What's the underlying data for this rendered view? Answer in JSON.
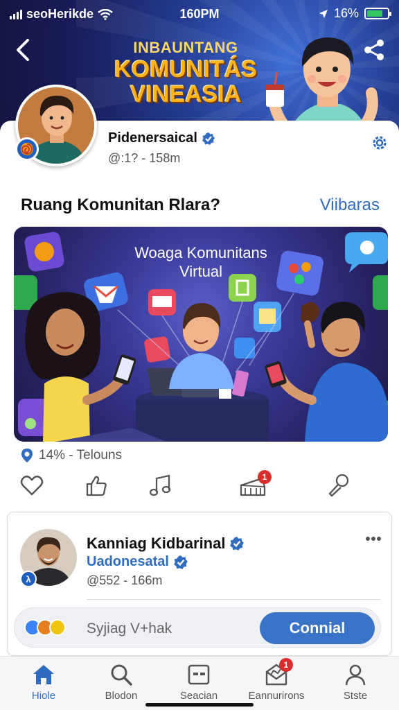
{
  "status_bar": {
    "carrier": "seoHerikde",
    "time": "160PM",
    "battery": "16%",
    "battery_level": 0.8
  },
  "banner": {
    "title_line1": "INBAUNTANG",
    "title_line2": "KOMUNITÁS",
    "title_line3": "VINEASIA"
  },
  "profile": {
    "name": "Pidenersaical",
    "handle": "@:1? - 158m"
  },
  "section": {
    "title": "Ruang Komunitan Rlara?",
    "link": "Viibaras"
  },
  "hero": {
    "title_line1": "Woaga Komunitans",
    "title_line2": "Virtual"
  },
  "engagement": {
    "text": "14% - Telouns"
  },
  "actions": {
    "notification_count": "1"
  },
  "post": {
    "name": "Kanniag Kidbarinal",
    "subtitle": "Uadonesatal",
    "handle": "@552 - 166m",
    "avatar_badge": "λ"
  },
  "composer": {
    "placeholder": "Syjiag V+hak",
    "button": "Connial"
  },
  "bottom_nav": {
    "items": [
      {
        "label": "Hiole",
        "icon": "home-icon",
        "active": true
      },
      {
        "label": "Blodon",
        "icon": "search-icon"
      },
      {
        "label": "Seacian",
        "icon": "messages-icon"
      },
      {
        "label": "Eannurirons",
        "icon": "notifications-icon",
        "badge": "1"
      },
      {
        "label": "Stste",
        "icon": "profile-icon"
      }
    ]
  },
  "colors": {
    "accent": "#2f6cc0",
    "button": "#3a74c9",
    "badge": "#d92d2d",
    "banner_bg": "#191c5a"
  }
}
